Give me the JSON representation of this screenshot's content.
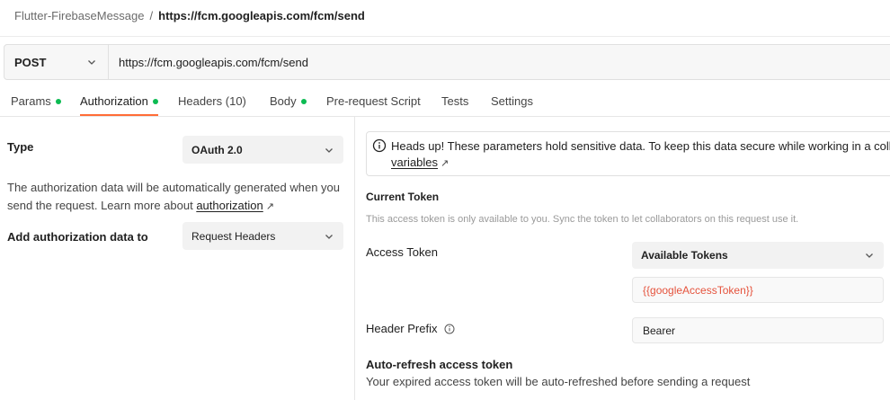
{
  "breadcrumb": {
    "parent": "Flutter-FirebaseMessage",
    "separator": "/",
    "current": "https://fcm.googleapis.com/fcm/send"
  },
  "request": {
    "method": "POST",
    "url": "https://fcm.googleapis.com/fcm/send"
  },
  "tabs": [
    {
      "label": "Params",
      "dot": true
    },
    {
      "label": "Authorization",
      "dot": true,
      "active": true
    },
    {
      "label": "Headers",
      "count": "(10)"
    },
    {
      "label": "Body",
      "dot": true
    },
    {
      "label": "Pre-request Script"
    },
    {
      "label": "Tests"
    },
    {
      "label": "Settings"
    }
  ],
  "auth": {
    "type_label": "Type",
    "type_value": "OAuth 2.0",
    "description_prefix": "The authorization data will be automatically generated when you send the request. Learn more about ",
    "description_link": "authorization",
    "add_to_label": "Add authorization data to",
    "add_to_value": "Request Headers"
  },
  "alert": {
    "text": "Heads up! These parameters hold sensitive data. To keep this data secure while working in a colla",
    "link": "variables"
  },
  "current_token": {
    "title": "Current Token",
    "note": "This access token is only available to you. Sync the token to let collaborators on this request use it.",
    "access_token_label": "Access Token",
    "available_tokens_label": "Available Tokens",
    "token_value": "{{googleAccessToken}}",
    "header_prefix_label": "Header Prefix",
    "header_prefix_value": "Bearer"
  },
  "auto_refresh": {
    "title": "Auto-refresh access token",
    "description": "Your expired access token will be auto-refreshed before sending a request"
  },
  "colors": {
    "accent": "#ff6c37",
    "status_dot": "#0cbb52",
    "variable": "#e5533d"
  }
}
